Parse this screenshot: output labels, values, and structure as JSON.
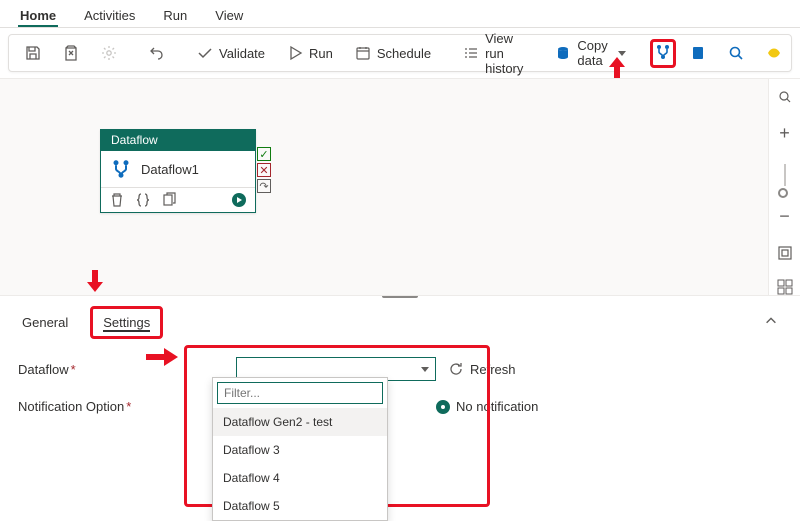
{
  "tabs": {
    "home": "Home",
    "activities": "Activities",
    "run": "Run",
    "view": "View"
  },
  "toolbar": {
    "validate": "Validate",
    "run": "Run",
    "schedule": "Schedule",
    "history": "View run history",
    "copy": "Copy data"
  },
  "node": {
    "type": "Dataflow",
    "name": "Dataflow1"
  },
  "lowerTabs": {
    "general": "General",
    "settings": "Settings"
  },
  "settings": {
    "dataflowLabel": "Dataflow",
    "notificationLabel": "Notification Option",
    "refresh": "Refresh",
    "noNotification": "No notification",
    "filterPlaceholder": "Filter...",
    "options": [
      "Dataflow Gen2 - test",
      "Dataflow 3",
      "Dataflow 4",
      "Dataflow 5"
    ]
  }
}
